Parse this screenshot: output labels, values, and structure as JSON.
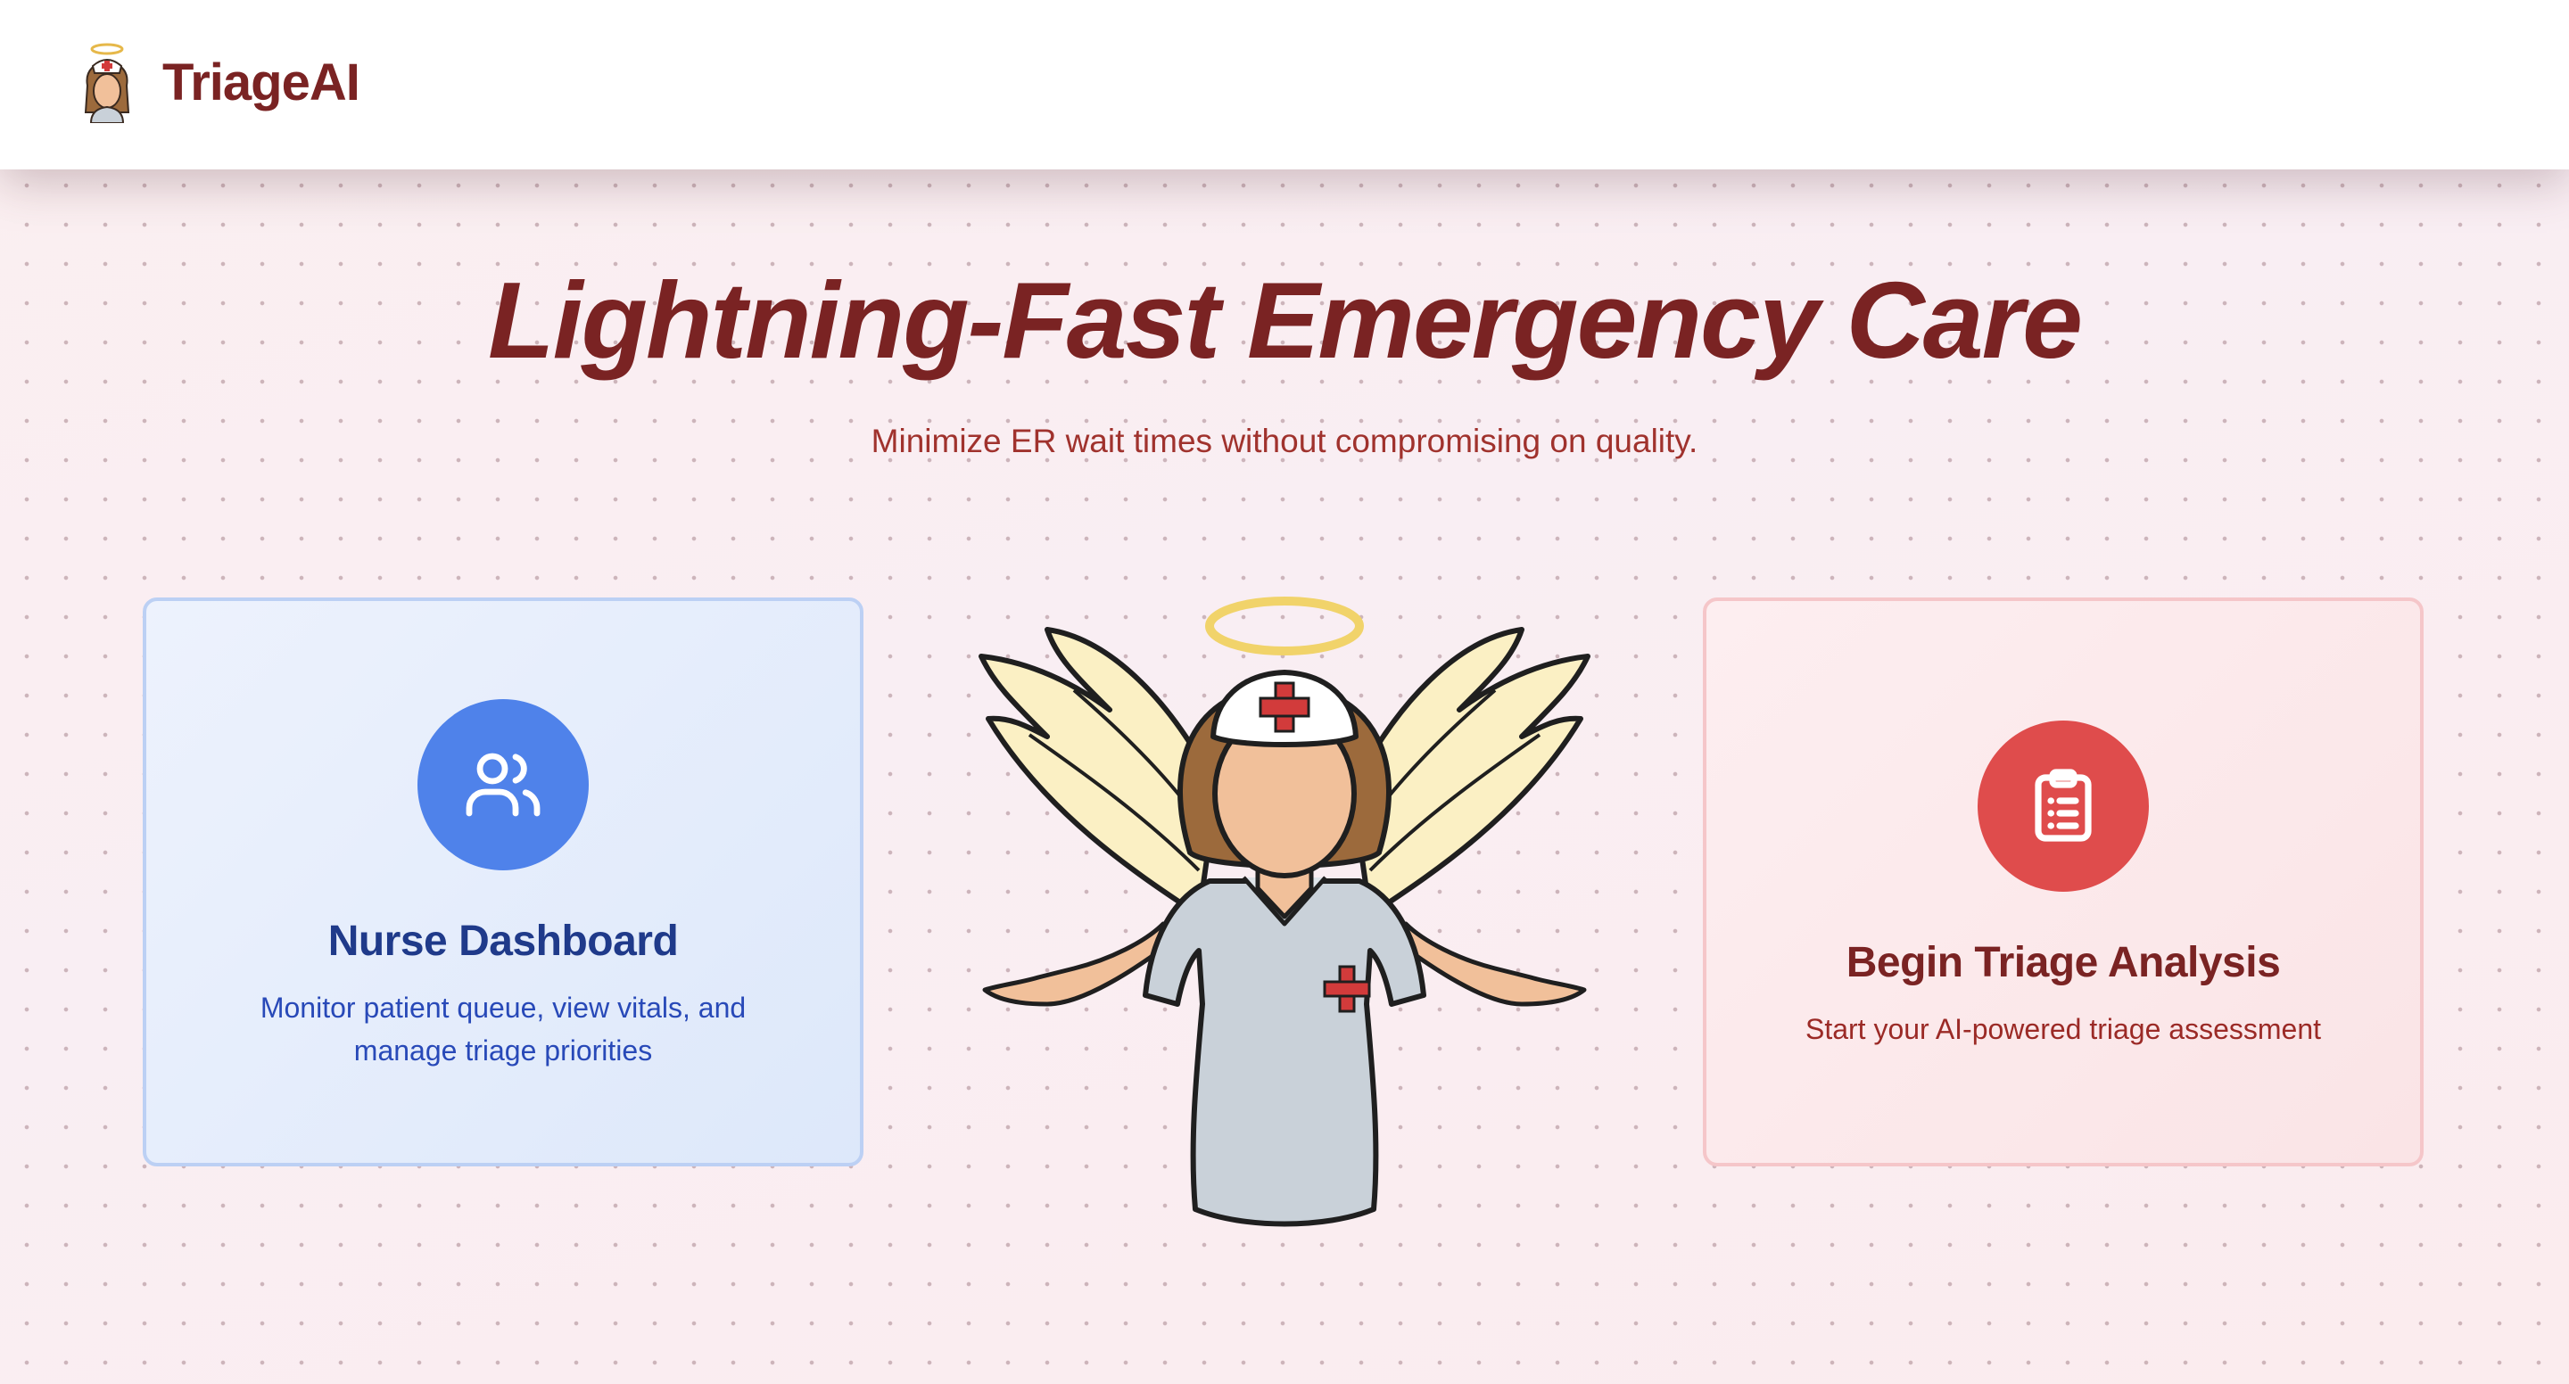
{
  "header": {
    "app_name": "TriageAI",
    "logo_icon": "angel-nurse-icon"
  },
  "hero": {
    "title": "Lightning-Fast Emergency Care",
    "subtitle": "Minimize ER wait times without compromising on quality."
  },
  "cards": {
    "nurse": {
      "icon": "users-icon",
      "title": "Nurse Dashboard",
      "description": "Monitor patient queue, view vitals, and manage triage priorities",
      "accent": "#4f82ea"
    },
    "triage": {
      "icon": "clipboard-list-icon",
      "title": "Begin Triage Analysis",
      "description": "Start your AI-powered triage assessment",
      "accent": "#df4c4c"
    }
  },
  "illustration": {
    "icon": "angel-nurse-illustration"
  },
  "colors": {
    "brand": "#7a2323",
    "subtitle": "#a0322d",
    "nurse_blue": "#1f3a8a"
  }
}
